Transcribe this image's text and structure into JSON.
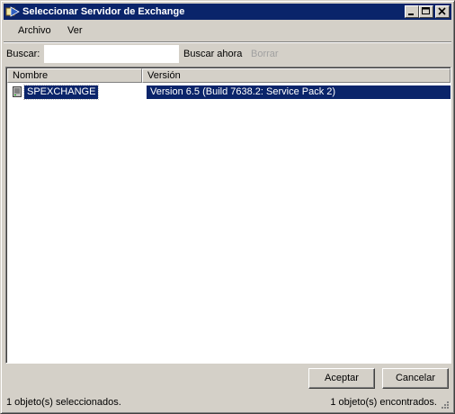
{
  "window": {
    "title": "Seleccionar Servidor de Exchange"
  },
  "menu": {
    "items": [
      {
        "label": "Archivo"
      },
      {
        "label": "Ver"
      }
    ]
  },
  "search": {
    "label": "Buscar:",
    "value": "",
    "search_now": "Buscar ahora",
    "clear": "Borrar"
  },
  "list": {
    "columns": [
      {
        "label": "Nombre"
      },
      {
        "label": "Versión"
      }
    ],
    "rows": [
      {
        "name": "SPEXCHANGE",
        "version": "Version 6.5 (Build 7638.2: Service Pack 2)"
      }
    ]
  },
  "buttons": {
    "ok": "Aceptar",
    "cancel": "Cancelar"
  },
  "status": {
    "selected": "1 objeto(s) seleccionados.",
    "found": "1 objeto(s) encontrados."
  },
  "colors": {
    "titlebar": "#0a246a",
    "face": "#d4d0c8",
    "selection": "#0a246a"
  }
}
